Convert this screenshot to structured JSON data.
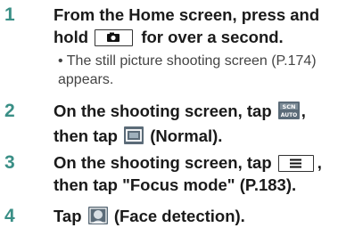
{
  "steps": [
    {
      "number": "1",
      "line1": "From the Home screen, press and",
      "line2a": "hold",
      "line2b": "for over a second.",
      "note_bullet": "•",
      "note_line1": "The still picture shooting screen (P.174)",
      "note_line2": "appears."
    },
    {
      "number": "2",
      "line1a": "On the shooting screen, tap",
      "line1b": ",",
      "line2a": "then tap",
      "line2b": "(Normal)."
    },
    {
      "number": "3",
      "line1a": "On the shooting screen, tap",
      "line1b": ",",
      "line2": "then tap \"Focus mode\" (P.183)."
    },
    {
      "number": "4",
      "line1a": "Tap",
      "line1b": "(Face detection)."
    }
  ],
  "icons": {
    "camera_key": "camera-key-icon",
    "scene_auto": "scn-auto-icon",
    "normal": "normal-mode-icon",
    "menu_key": "menu-key-icon",
    "face_detection": "face-detection-icon"
  },
  "colors": {
    "step_number": "#3a8f86",
    "text": "#1a1a1a",
    "note": "#444444"
  }
}
